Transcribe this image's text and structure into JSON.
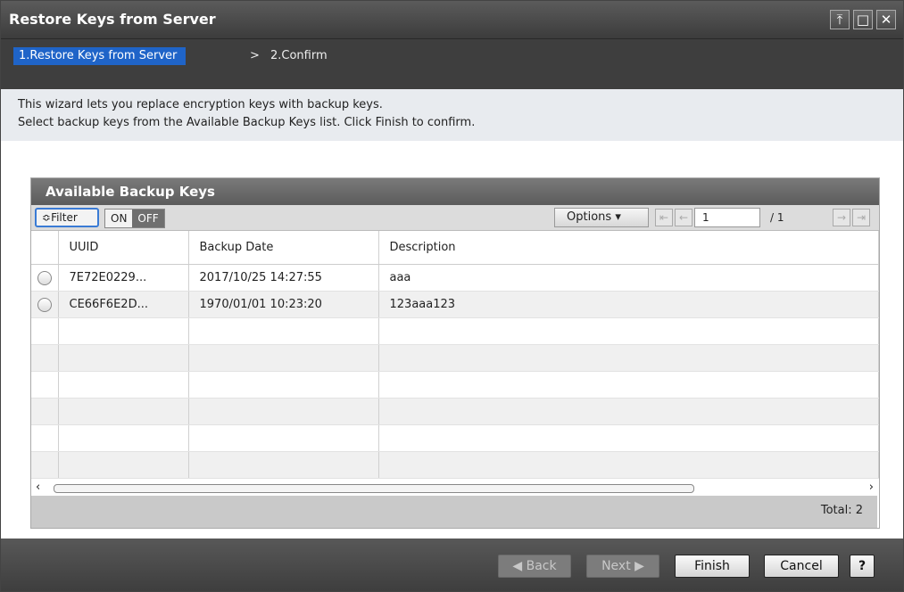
{
  "window": {
    "title": "Restore Keys from Server"
  },
  "steps": {
    "current": "1.Restore Keys from Server",
    "separator": ">",
    "next": "2.Confirm"
  },
  "intro": {
    "line1": "This wizard lets you replace encryption keys with backup keys.",
    "line2": "Select backup keys from the Available Backup Keys list. Click Finish to confirm."
  },
  "panel": {
    "title": "Available Backup Keys",
    "filter_label": "Filter",
    "toggle_on": "ON",
    "toggle_off": "OFF",
    "options_label": "Options",
    "page_value": "1",
    "page_total": "/ 1",
    "columns": [
      "UUID",
      "Backup Date",
      "Description"
    ],
    "rows": [
      {
        "uuid": "7E72E0229...",
        "date": "2017/10/25 14:27:55",
        "desc": "aaa"
      },
      {
        "uuid": "CE66F6E2D...",
        "date": "1970/01/01 10:23:20",
        "desc": "123aaa123"
      }
    ],
    "total": "Total:  2"
  },
  "buttons": {
    "back": "◀ Back",
    "next": "Next ▶",
    "finish": "Finish",
    "cancel": "Cancel",
    "help": "?"
  },
  "colors": {
    "accent": "#1f64c8",
    "filter_border": "#3a7bd5"
  }
}
